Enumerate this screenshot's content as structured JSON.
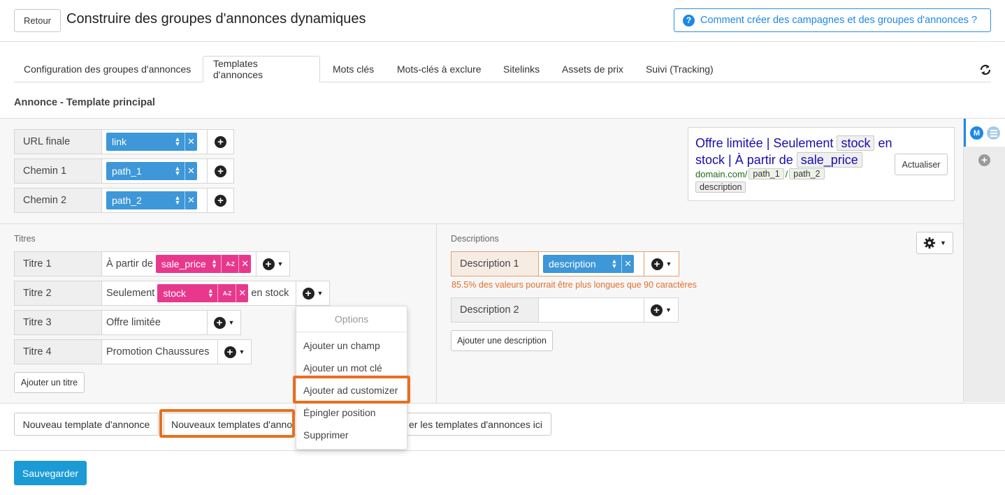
{
  "header": {
    "back_label": "Retour",
    "title": "Construire des groupes d'annonces dynamiques",
    "help_label": "Comment créer des campagnes et des groupes d'annonces ?",
    "help_icon": "?"
  },
  "tabs": [
    {
      "label": "Configuration des groupes d'annonces",
      "active": false
    },
    {
      "label": "Templates d'annonces",
      "active": true
    },
    {
      "label": "Mots clés",
      "active": false
    },
    {
      "label": "Mots-clés à exclure",
      "active": false
    },
    {
      "label": "Sitelinks",
      "active": false
    },
    {
      "label": "Assets de prix",
      "active": false
    },
    {
      "label": "Suivi (Tracking)",
      "active": false
    }
  ],
  "section_title": "Annonce - Template principal",
  "url_rows": [
    {
      "label": "URL finale",
      "token": "link"
    },
    {
      "label": "Chemin 1",
      "token": "path_1"
    },
    {
      "label": "Chemin 2",
      "token": "path_2"
    }
  ],
  "preview": {
    "headline_1": "Offre limitée | Seulement",
    "headline_token_1": "stock",
    "headline_2": "en",
    "headline_3": "stock | À partir de",
    "headline_token_2": "sale_price",
    "domain": "domain.com/",
    "path_1": "path_1",
    "separator": "/",
    "path_2": "path_2",
    "description": "description",
    "refresh_label": "Actualiser"
  },
  "titles": {
    "section_label": "Titres",
    "rows": [
      {
        "label": "Titre 1",
        "prefix": "À partir de",
        "token": "sale_price",
        "suffix": ""
      },
      {
        "label": "Titre 2",
        "prefix": "Seulement",
        "token": "stock",
        "suffix": "en stock"
      },
      {
        "label": "Titre 3",
        "text": "Offre limitée"
      },
      {
        "label": "Titre 4",
        "text": "Promotion Chaussures"
      }
    ],
    "add_label": "Ajouter un titre",
    "az_label": "A-Z"
  },
  "descriptions": {
    "section_label": "Descriptions",
    "rows": [
      {
        "label": "Description 1",
        "token": "description"
      },
      {
        "label": "Description 2",
        "value": ""
      }
    ],
    "warning": "85.5% des valeurs pourrait être plus longues que 90 caractères",
    "add_label": "Ajouter une description"
  },
  "options_menu": {
    "header": "Options",
    "items": [
      "Ajouter un champ",
      "Ajouter un mot clé",
      "Ajouter ad customizer",
      "Épingler position",
      "Supprimer"
    ],
    "highlighted": "Ajouter ad customizer"
  },
  "footer": {
    "new_template": "Nouveau template d'annonce",
    "new_templates_partial": "Nouveaux templates d'anno",
    "import_partial": "er les templates d'annonces ici",
    "save": "Sauvegarder"
  },
  "sidebar": {
    "avatar_letter": "M"
  },
  "colors": {
    "accent_blue": "#3d97d8",
    "token_pink": "#e8388e",
    "highlight_orange": "#e86f1f",
    "save_blue": "#1b9ad6",
    "warning": "#e2702a"
  },
  "icons": [
    "refresh-icon",
    "help-icon",
    "plus-circle-icon",
    "gear-icon",
    "list-icon",
    "caret-down-icon"
  ]
}
